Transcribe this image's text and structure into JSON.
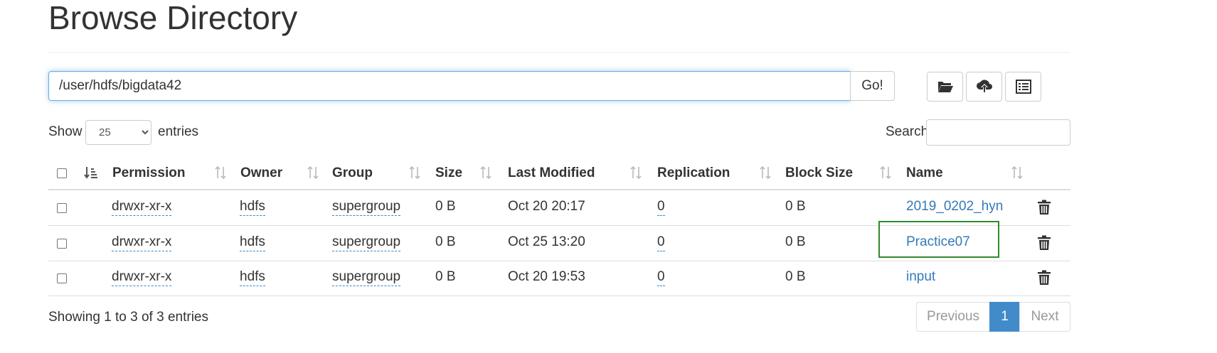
{
  "page": {
    "title": "Browse Directory"
  },
  "toolbar": {
    "path_value": "/user/hdfs/bigdata42",
    "go_label": "Go!",
    "buttons": [
      "create-directory",
      "upload-files",
      "cut-paste"
    ]
  },
  "length": {
    "prefix": "Show",
    "value": "25",
    "suffix": "entries",
    "options": [
      "25"
    ]
  },
  "search": {
    "label": "Search:"
  },
  "table": {
    "headers": {
      "permission": "Permission",
      "owner": "Owner",
      "group": "Group",
      "size": "Size",
      "last_modified": "Last Modified",
      "replication": "Replication",
      "block_size": "Block Size",
      "name": "Name"
    },
    "rows": [
      {
        "permission": "drwxr-xr-x",
        "owner": "hdfs",
        "group": "supergroup",
        "size": "0 B",
        "last_modified": "Oct 20 20:17",
        "replication": "0",
        "block_size": "0 B",
        "name": "2019_0202_hyn"
      },
      {
        "permission": "drwxr-xr-x",
        "owner": "hdfs",
        "group": "supergroup",
        "size": "0 B",
        "last_modified": "Oct 25 13:20",
        "replication": "0",
        "block_size": "0 B",
        "name": "Practice07"
      },
      {
        "permission": "drwxr-xr-x",
        "owner": "hdfs",
        "group": "supergroup",
        "size": "0 B",
        "last_modified": "Oct 20 19:53",
        "replication": "0",
        "block_size": "0 B",
        "name": "input"
      }
    ]
  },
  "footer": {
    "info": "Showing 1 to 3 of 3 entries",
    "previous": "Previous",
    "current_page": "1",
    "next": "Next"
  },
  "colors": {
    "link": "#337ab7",
    "highlight": "#2e8b2e",
    "active_page": "#428bca"
  }
}
